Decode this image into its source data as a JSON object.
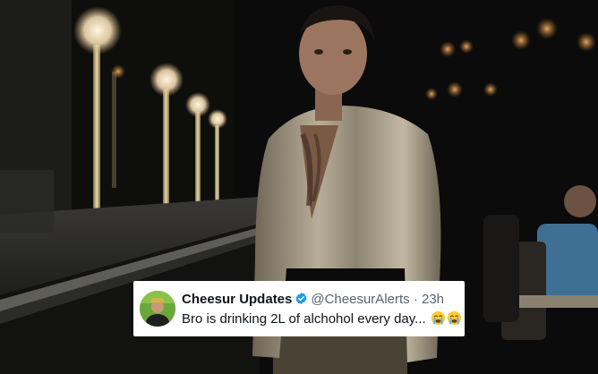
{
  "tweet": {
    "display_name": "Cheesur Updates",
    "handle": "@CheesurAlerts",
    "separator": "·",
    "time": "23h",
    "text": "Bro is drinking 2L of alchohol every day...",
    "emojis": [
      "loudly-crying-face-icon",
      "loudly-crying-face-icon"
    ],
    "verified_color": "#1d9bf0"
  },
  "colors": {
    "card_background": "#ffffff",
    "name_text": "#0f1419",
    "secondary_text": "#536471"
  }
}
